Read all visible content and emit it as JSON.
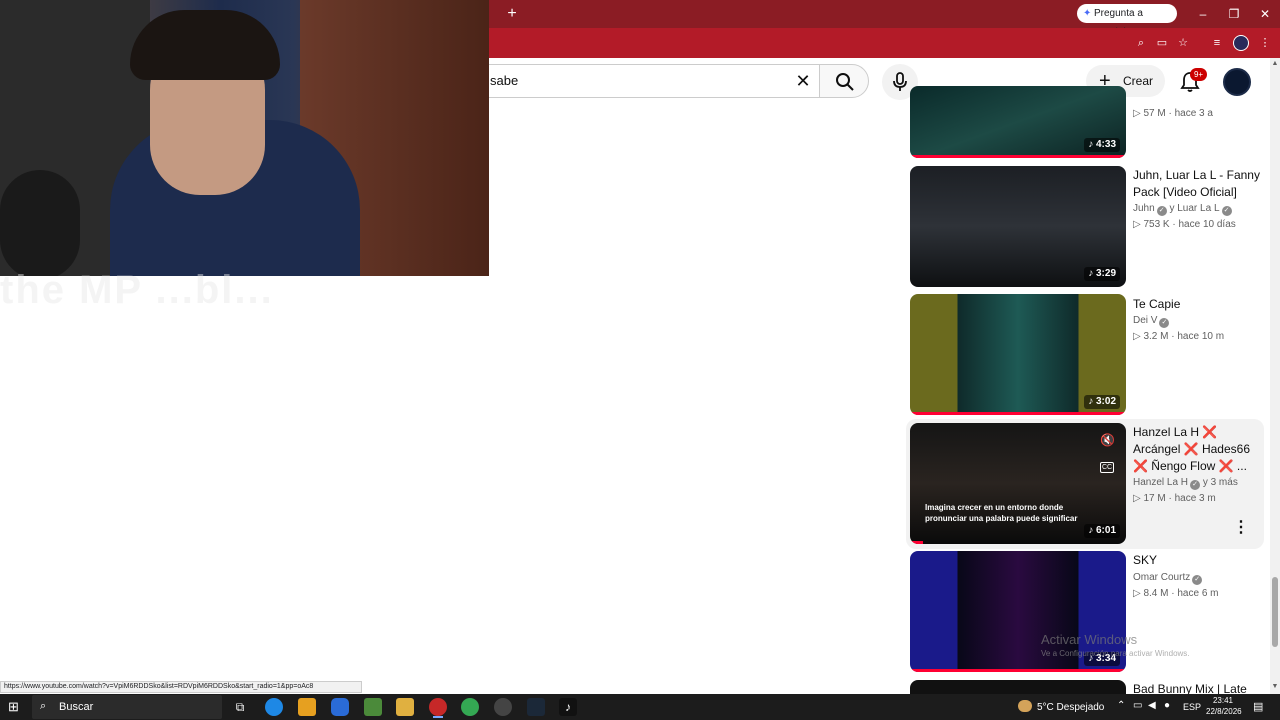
{
  "browser": {
    "new_tab_symbol": "+",
    "gemini_label": "Pregunta a Gemini",
    "window_controls": {
      "minimize": "–",
      "maximize": "❐",
      "close": "✕"
    },
    "accent": "#b31b28"
  },
  "header": {
    "search_value": "sabe",
    "create_label": "Crear",
    "notification_count": "9+"
  },
  "webcam_overlay_text": "the MP ...bl...",
  "videos": [
    {
      "title": "",
      "channel": "",
      "views": "57 M",
      "age": "hace 3 a",
      "duration": "4:33"
    },
    {
      "title": "Juhn, Luar La L - Fanny Pack [Video Oficial]",
      "channel": "Juhn",
      "channel_extra": "y Luar La L",
      "views": "753 K",
      "age": "hace 10 días",
      "duration": "3:29"
    },
    {
      "title": "Te Capie",
      "channel": "Dei V",
      "views": "3.2 M",
      "age": "hace 10 m",
      "duration": "3:02"
    },
    {
      "title": "Hanzel La H ❌ Arcángel ❌ Hades66 ❌ Ñengo Flow ❌ ...",
      "channel": "Hanzel La H",
      "channel_extra": "y 3 más",
      "views": "17 M",
      "age": "hace 3 m",
      "duration": "6:01",
      "caption": "Imagina crecer en un entorno donde pronunciar una palabra puede significar"
    },
    {
      "title": "SKY",
      "channel": "Omar Courtz",
      "views": "8.4 M",
      "age": "hace 6 m",
      "duration": "3:34"
    },
    {
      "title": "Bad Bunny Mix | Late"
    }
  ],
  "watermark": {
    "title": "Activar Windows",
    "subtitle": "Ve a Configuración para activar Windows."
  },
  "status_url": "https://www.youtube.com/watch?v=VpiM6RDDSko&list=RDVpiM6RDDSko&start_radio=1&pp=oAc8",
  "taskbar": {
    "search_label": "Buscar",
    "weather": "5°C  Despejado",
    "language": "ESP",
    "time": "23:41",
    "date": "22/8/2026"
  }
}
